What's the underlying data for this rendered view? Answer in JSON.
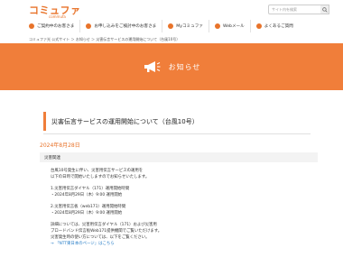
{
  "header": {
    "logo_main": "コミュファ",
    "logo_sub": "commufa",
    "search_placeholder": "サイト内を検索"
  },
  "nav": [
    {
      "label": "ご契約中のお客さま"
    },
    {
      "label": "お申し込みをご検討中のお客さま"
    },
    {
      "label": "Myコミュファ"
    },
    {
      "label": "Webメール"
    },
    {
      "label": "よくあるご質問"
    }
  ],
  "breadcrumb": "コミュファ光 公式サイト ＞ お知らせ ＞ 災害伝言サービスの運用開始について（台風10号）",
  "banner": {
    "title": "お知らせ"
  },
  "article": {
    "title": "災害伝言サービスの運用開始について（台風10号）",
    "date": "2024年8月28日",
    "category": "災害関連",
    "lines": [
      "台風10号発生に伴い、災害用伝言サービスの運用を",
      "以下の日時で開始いたしますのでお知らせいたします。",
      "",
      "1.災害用伝言ダイヤル（171）運用開始時間",
      "・2024年8月29日（木）9:00 運用開始",
      "",
      "2.災害用伝言板（web171）運用開始時間",
      "・2024年8月29日（木）9:00 運用開始",
      "",
      "詳細については、災害用伝言ダイヤル（171）および災害用",
      "ブロードバンド伝言板Web171提供機関でご覧いただけます。",
      "災害発生時の使い方については、以下をご覧ください。",
      "→ 「NTT東日本のページ」はこちら"
    ]
  }
}
